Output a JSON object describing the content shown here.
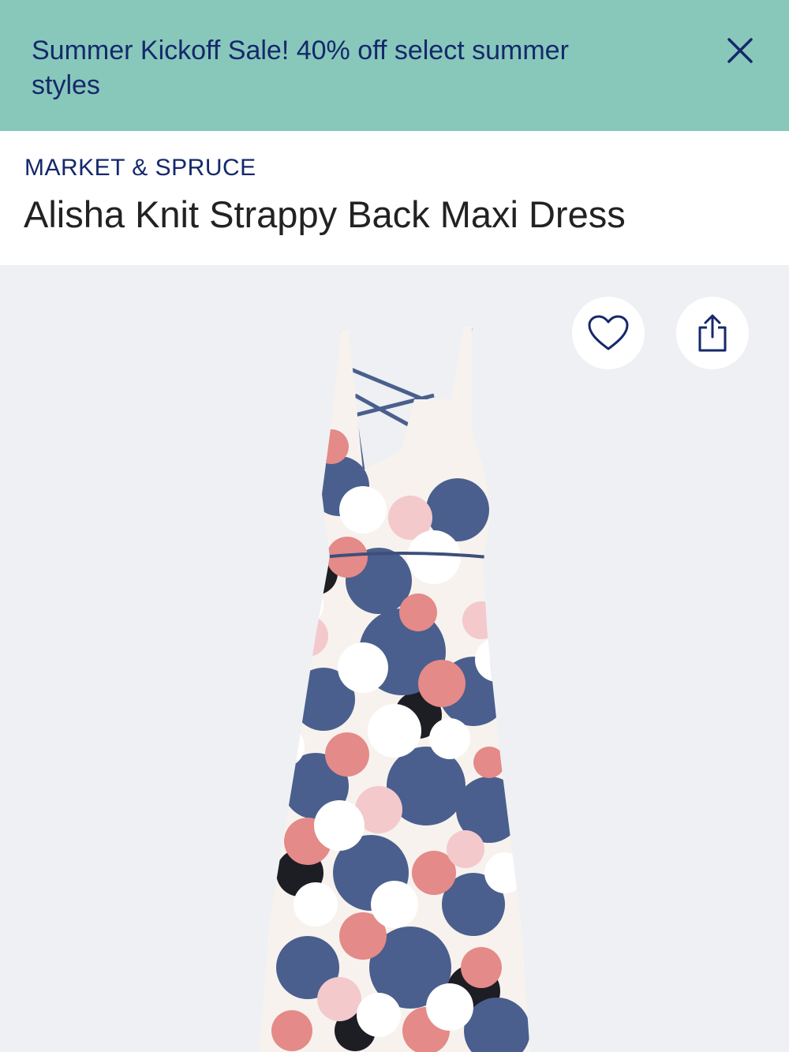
{
  "banner": {
    "text": "Summer Kickoff Sale! 40% off select summer styles",
    "close_icon": "close-icon",
    "background": "#87c8bb",
    "text_color": "#16286b"
  },
  "product": {
    "brand": "MARKET & SPRUCE",
    "title": "Alisha Knit Strappy Back Maxi Dress"
  },
  "actions": {
    "favorite_icon": "heart-icon",
    "share_icon": "share-icon"
  },
  "image": {
    "background": "#eef0f3",
    "palette": [
      "#4a5f8d",
      "#e48a88",
      "#f7f2ee",
      "#1d1d24",
      "#f3c9cc"
    ]
  }
}
